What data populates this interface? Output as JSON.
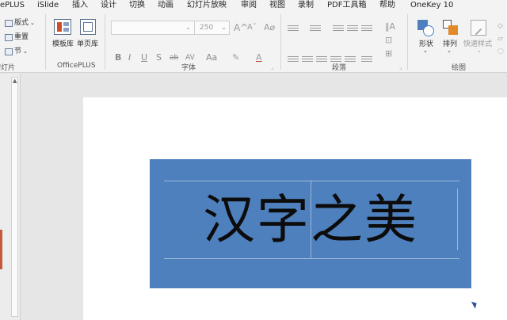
{
  "tabs": [
    "ePLUS",
    "iSlide",
    "插入",
    "设计",
    "切换",
    "动画",
    "幻灯片放映",
    "审阅",
    "视图",
    "录制",
    "PDF工具箱",
    "帮助",
    "OneKey 10"
  ],
  "slides_group": {
    "layout_label": "版式",
    "reset_label": "重置",
    "section_label": "节",
    "group_label": "幻灯片"
  },
  "officeplus_group": {
    "template_label": "模板库",
    "single_page_label": "单页库",
    "group_label": "OfficePLUS"
  },
  "font_group": {
    "font_size_value": "250",
    "format_buttons": [
      "B",
      "I",
      "U",
      "S",
      "ab",
      "AV",
      "Aa"
    ],
    "group_label": "字体"
  },
  "paragraph_group": {
    "group_label": "段落"
  },
  "drawing_group": {
    "shape_label": "形状",
    "arrange_label": "排列",
    "quick_style_label": "快速样式",
    "group_label": "绘图"
  },
  "slide": {
    "title_text": "汉字之美",
    "box_color": "#4e80bd"
  }
}
